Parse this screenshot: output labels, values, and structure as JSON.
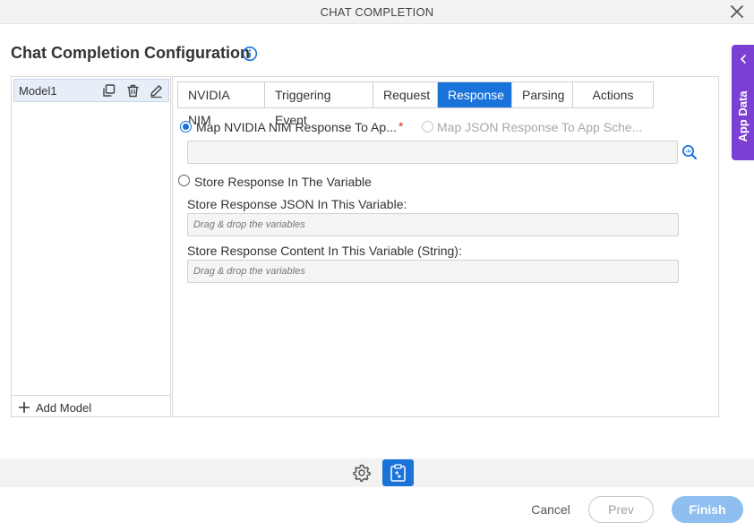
{
  "window": {
    "title": "CHAT COMPLETION"
  },
  "page": {
    "heading": "Chat Completion Configuration"
  },
  "side_tab": {
    "label": "App Data"
  },
  "models": {
    "items": [
      {
        "name": "Model1"
      }
    ],
    "add_label": "Add Model"
  },
  "tabs": [
    {
      "label": "NVIDIA NIM"
    },
    {
      "label": "Triggering Event"
    },
    {
      "label": "Request"
    },
    {
      "label": "Response",
      "active": true
    },
    {
      "label": "Parsing"
    },
    {
      "label": "Actions"
    }
  ],
  "response": {
    "option_map_nim": "Map NVIDIA NIM Response To Ap...",
    "required_mark": "*",
    "option_map_json": "Map JSON Response To App Sche...",
    "option_store_variable": "Store Response In The Variable",
    "json_var_label": "Store Response JSON In This Variable:",
    "json_var_placeholder": "Drag & drop the variables",
    "content_var_label": "Store Response Content In This Variable (String):",
    "content_var_placeholder": "Drag & drop the variables"
  },
  "footer": {
    "cancel": "Cancel",
    "prev": "Prev",
    "finish": "Finish"
  },
  "colors": {
    "accent": "#1a73d9",
    "app_data_tab": "#7b3fd4",
    "required": "#d32f2f"
  }
}
